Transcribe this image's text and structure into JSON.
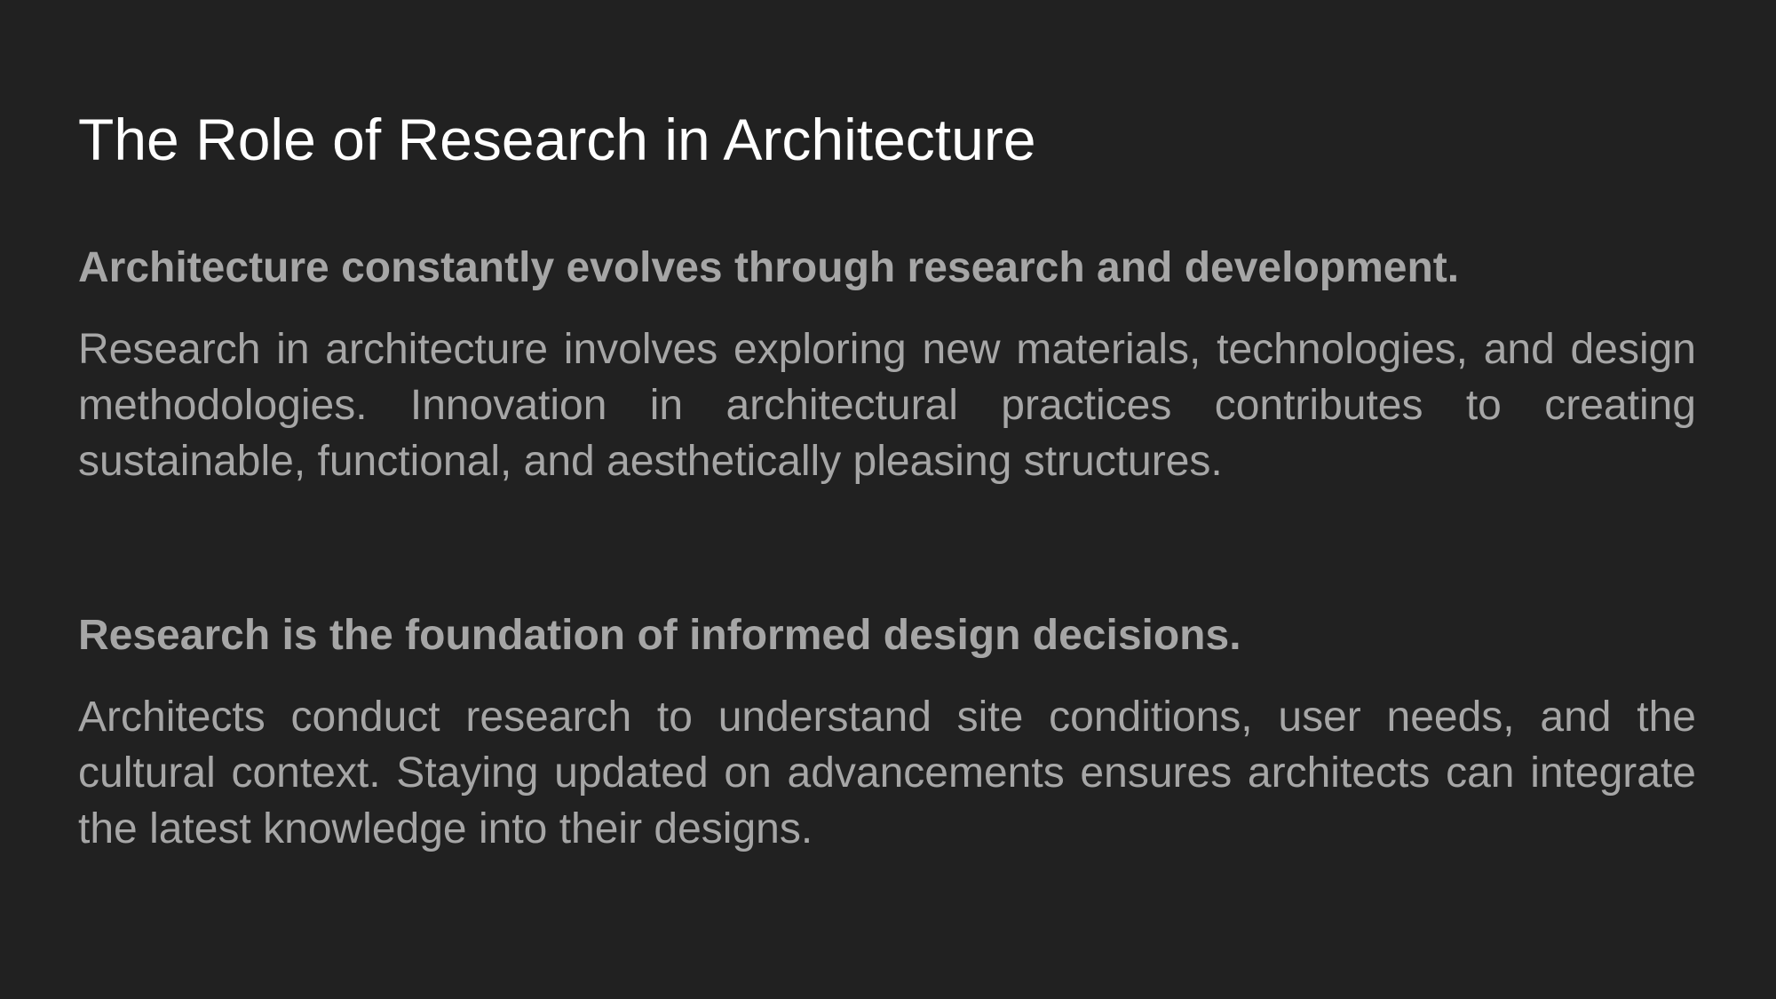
{
  "slide": {
    "title": "The Role of Research in Architecture",
    "sections": [
      {
        "heading": "Architecture constantly evolves through research and development.",
        "body": "Research in architecture involves exploring new materials, technologies, and design methodologies. Innovation in architectural practices contributes to creating sustainable, functional, and aesthetically pleasing structures."
      },
      {
        "heading": "Research is the foundation of informed design decisions.",
        "body": "Architects conduct research to understand site conditions, user needs, and the cultural context. Staying updated on advancements ensures architects can integrate the latest knowledge into their designs."
      }
    ]
  },
  "colors": {
    "background": "#212121",
    "title": "#ffffff",
    "text": "#a6a6a6"
  }
}
